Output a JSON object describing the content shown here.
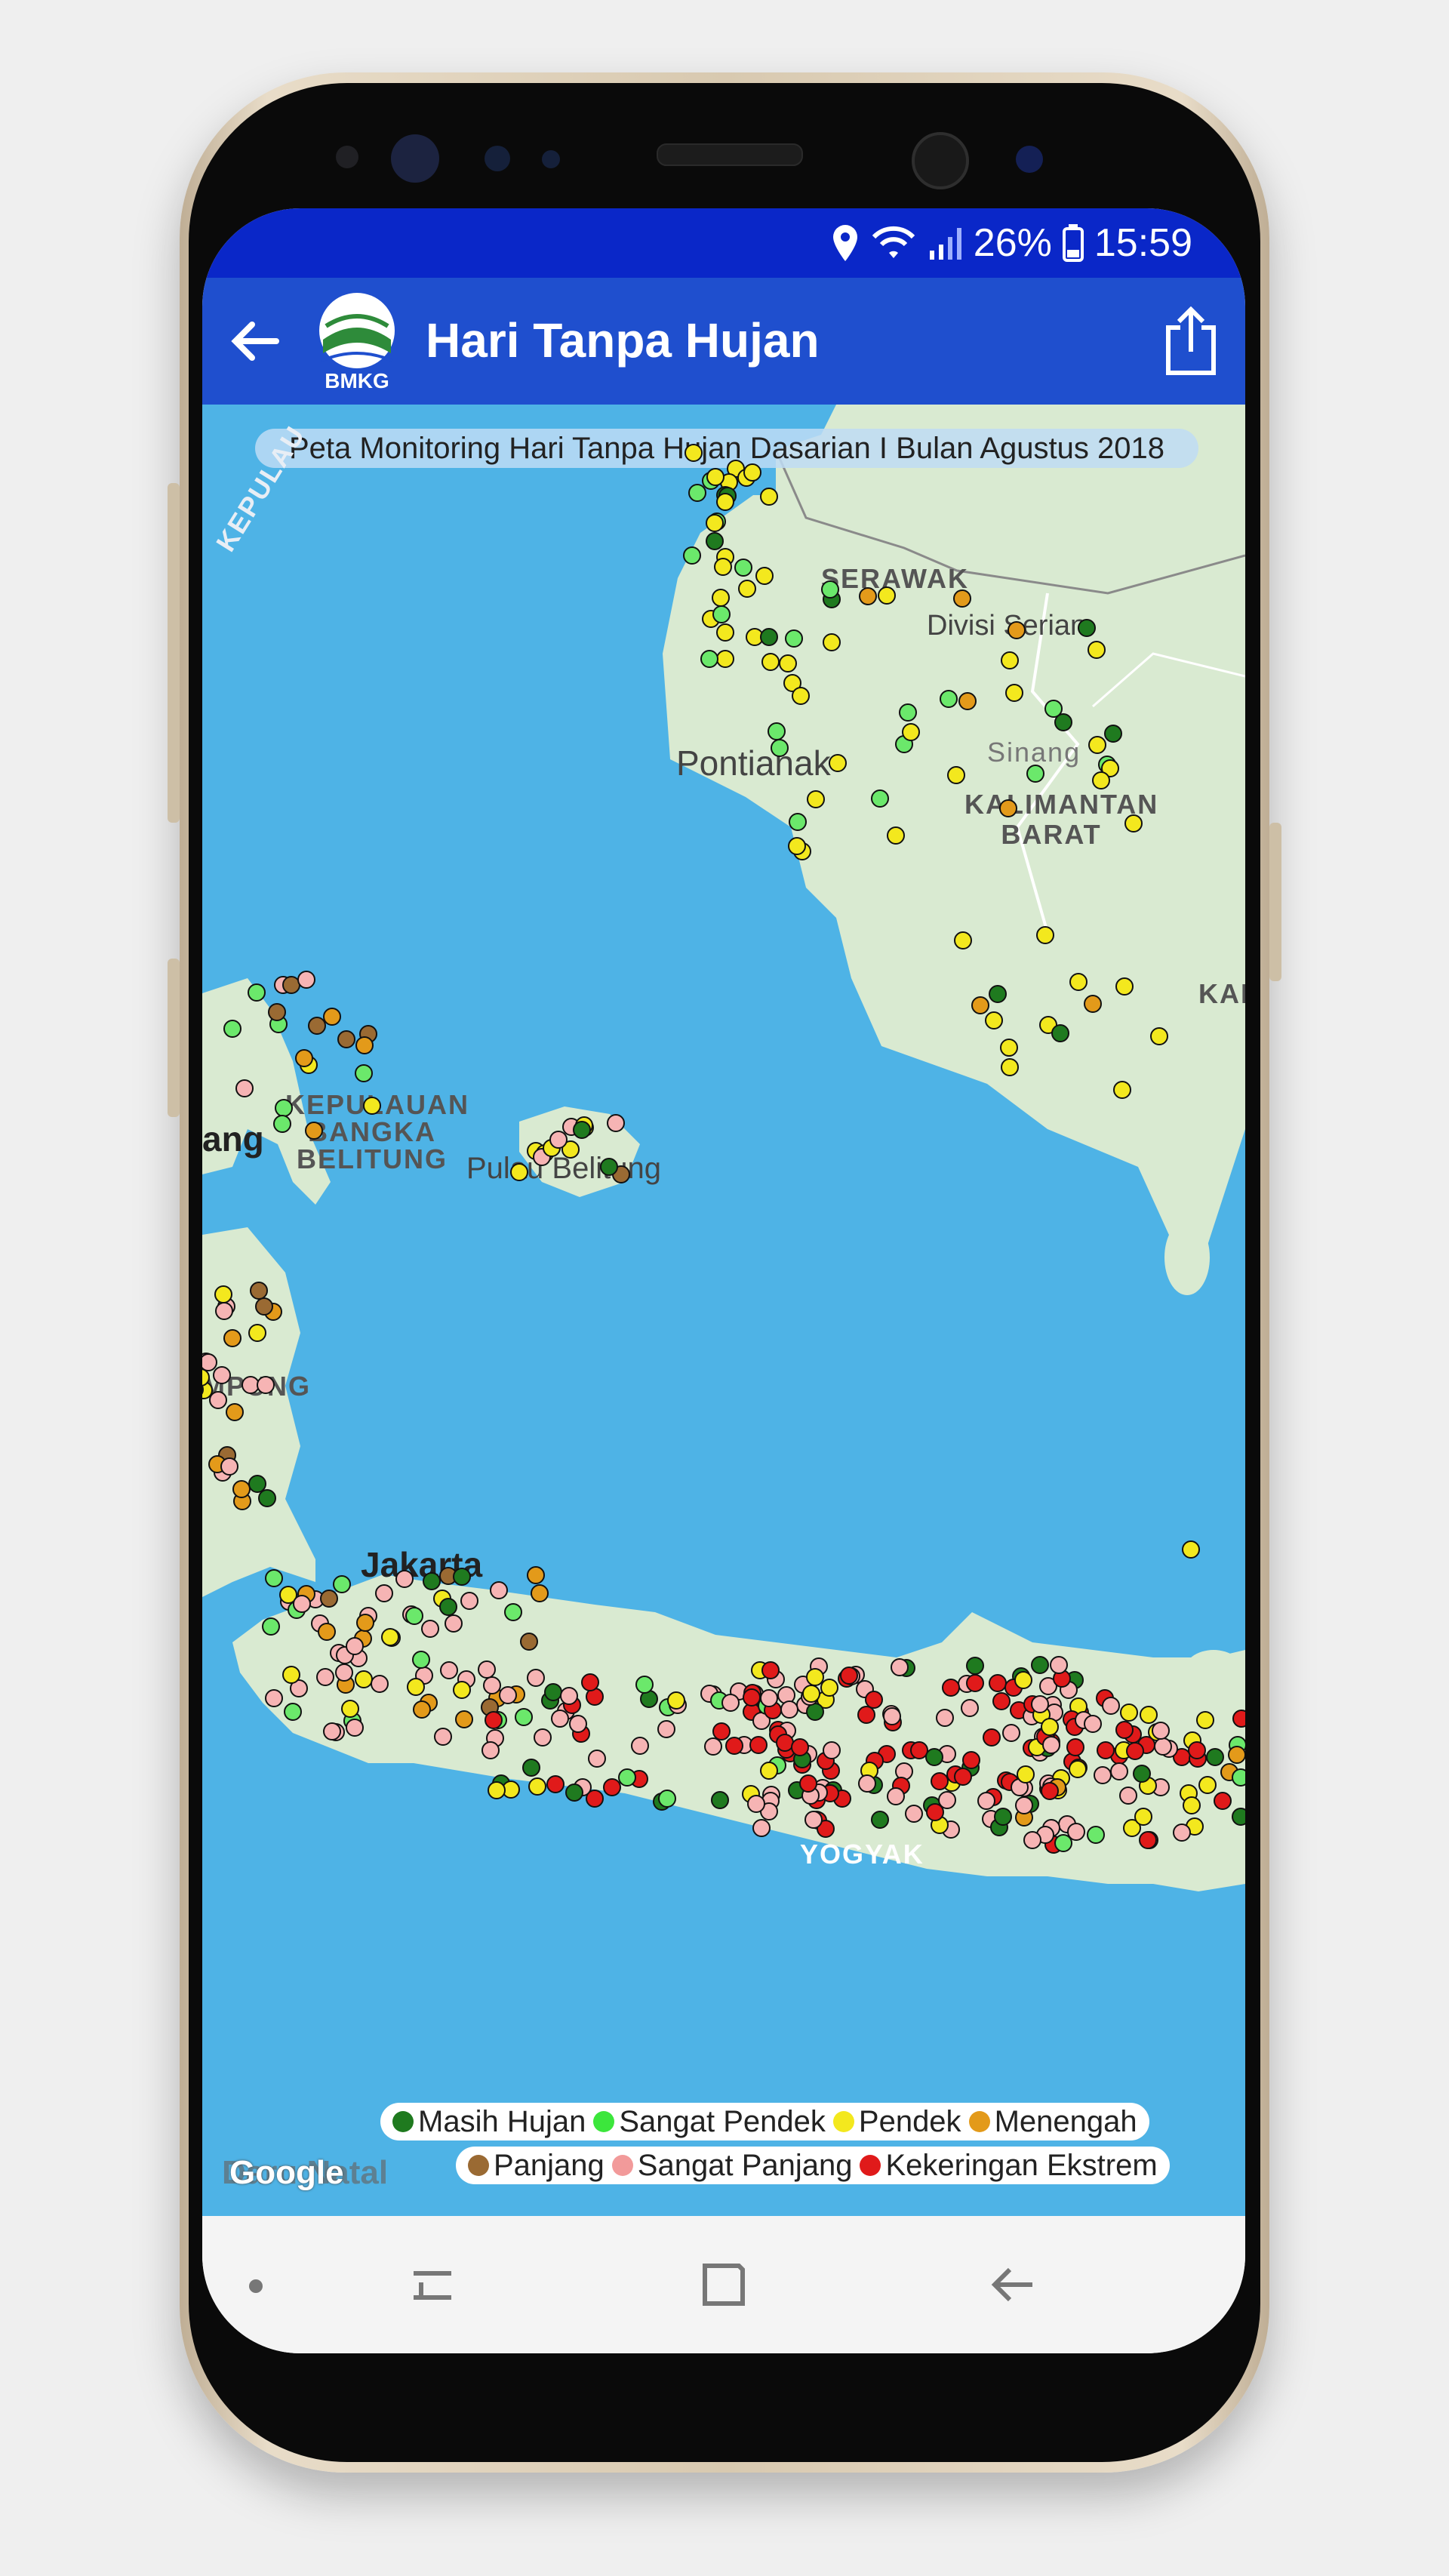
{
  "status_bar": {
    "battery": "26%",
    "time": "15:59"
  },
  "app_bar": {
    "logo_text": "BMKG",
    "title": "Hari Tanpa Hujan"
  },
  "map": {
    "title": "Peta Monitoring Hari Tanpa Hujan Dasarian I Bulan Agustus 2018",
    "labels": [
      "SERAWAK",
      "Divisi Serian",
      "Pontianak",
      "Sinang",
      "KALIMANTAN BARAT",
      "KAL",
      "KEPULAUAN BANGKA BELITUNG",
      "ang",
      "Pulau Belitung",
      "MPUNG",
      "Jakarta",
      "YOGYAK",
      "KEPULAU"
    ],
    "attribution": "Google",
    "corner_text": "Daru Natal"
  },
  "legend": {
    "row1": [
      {
        "label": "Masih Hujan",
        "color": "#1f7a1f"
      },
      {
        "label": "Sangat Pendek",
        "color": "#3ce63c"
      },
      {
        "label": "Pendek",
        "color": "#f3e81e"
      },
      {
        "label": "Menengah",
        "color": "#e39a1a"
      }
    ],
    "row2": [
      {
        "label": "Panjang",
        "color": "#9a6a33"
      },
      {
        "label": "Sangat Panjang",
        "color": "#f29a9a"
      },
      {
        "label": "Kekeringan Ekstrem",
        "color": "#e01a1a"
      }
    ]
  },
  "colors": {
    "status_bar": "#0a27c8",
    "app_bar": "#1f4fce",
    "sea": "#4eb3e6",
    "land": "#d9ead1"
  },
  "icons": [
    "location-icon",
    "wifi-icon",
    "signal-icon",
    "battery-icon",
    "back-arrow-icon",
    "share-icon",
    "recent-apps-icon",
    "home-icon",
    "nav-back-icon"
  ]
}
